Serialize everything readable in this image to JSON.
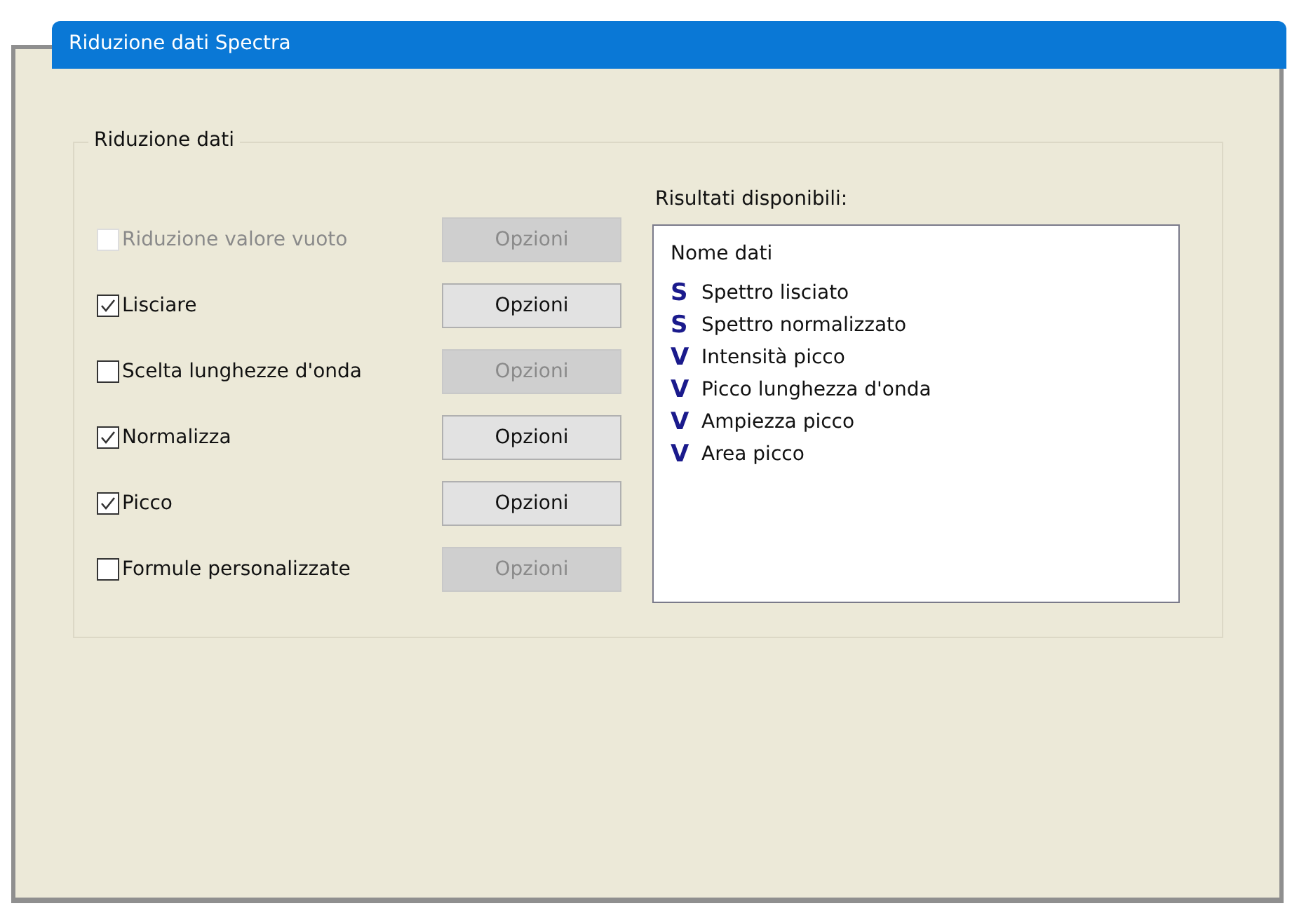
{
  "window": {
    "title": "Riduzione dati Spectra"
  },
  "group": {
    "title": "Riduzione dati",
    "options": [
      {
        "label": "Riduzione valore vuoto",
        "checked": false,
        "disabled": true,
        "button": {
          "label": "Opzioni",
          "disabled": true
        }
      },
      {
        "label": "Lisciare",
        "checked": true,
        "disabled": false,
        "button": {
          "label": "Opzioni",
          "disabled": false
        }
      },
      {
        "label": "Scelta lunghezze d'onda",
        "checked": false,
        "disabled": false,
        "button": {
          "label": "Opzioni",
          "disabled": true
        }
      },
      {
        "label": "Normalizza",
        "checked": true,
        "disabled": false,
        "button": {
          "label": "Opzioni",
          "disabled": false
        }
      },
      {
        "label": "Picco",
        "checked": true,
        "disabled": false,
        "button": {
          "label": "Opzioni",
          "disabled": false
        }
      },
      {
        "label": "Formule personalizzate",
        "checked": false,
        "disabled": false,
        "button": {
          "label": "Opzioni",
          "disabled": true
        }
      }
    ]
  },
  "results": {
    "title": "Risultati disponibili:",
    "header": "Nome dati",
    "items": [
      {
        "symbol": "S",
        "label": "Spettro lisciato"
      },
      {
        "symbol": "S",
        "label": "Spettro normalizzato"
      },
      {
        "symbol": "V",
        "label": "Intensità picco"
      },
      {
        "symbol": "V",
        "label": "Picco lunghezza d'onda"
      },
      {
        "symbol": "V",
        "label": "Ampiezza picco"
      },
      {
        "symbol": "V",
        "label": "Area picco"
      }
    ]
  }
}
